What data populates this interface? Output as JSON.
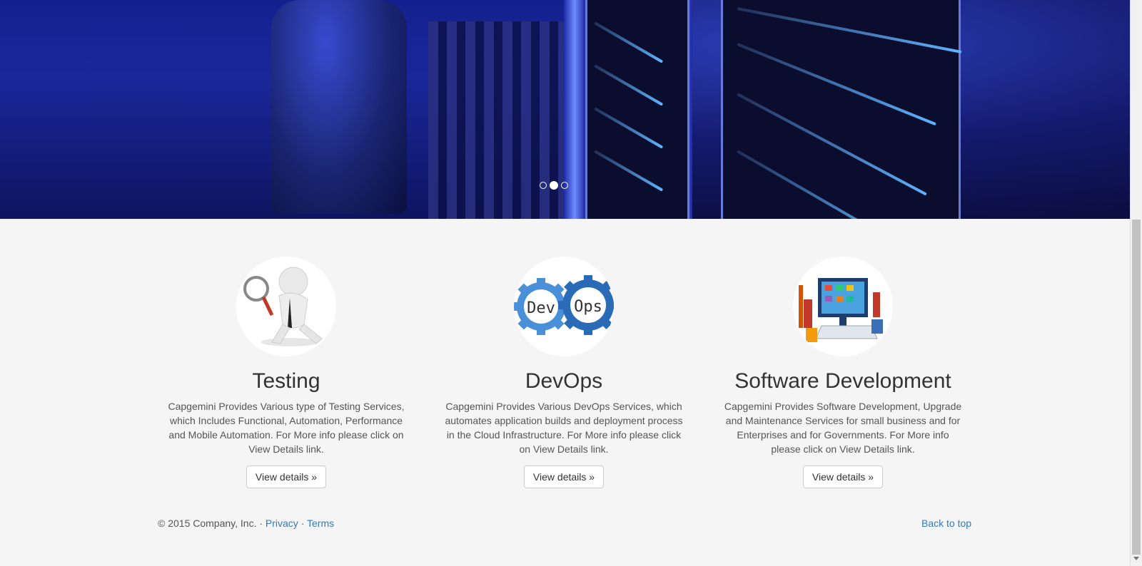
{
  "carousel": {
    "slides": 3,
    "active_index": 1
  },
  "features": [
    {
      "title": "Testing",
      "description": "Capgemini Provides Various type of Testing Services, which Includes Functional, Automation, Performance and Mobile Automation. For More info please click on View Details link.",
      "button_label": "View details »",
      "icon": "magnifier-figure-icon"
    },
    {
      "title": "DevOps",
      "description": "Capgemini Provides Various DevOps Services, which automates application builds and deployment process in the Cloud Infrastructure. For More info please click on View Details link.",
      "button_label": "View details »",
      "icon": "gears-icon",
      "image_text": {
        "dev": "Dev",
        "ops": "Ops"
      }
    },
    {
      "title": "Software Development",
      "description": "Capgemini Provides Software Development, Upgrade and Maintenance Services for small business and for Enterprises and for Governments. For More info please click on View Details link.",
      "button_label": "View details »",
      "icon": "developers-screen-icon"
    }
  ],
  "footer": {
    "copyright": "© 2015 Company, Inc. · ",
    "privacy": "Privacy",
    "separator": " · ",
    "terms": "Terms",
    "back_to_top": "Back to top"
  },
  "colors": {
    "link": "#337ab7",
    "background": "#f5f5f5",
    "devops_blue": "#2f72c0"
  }
}
